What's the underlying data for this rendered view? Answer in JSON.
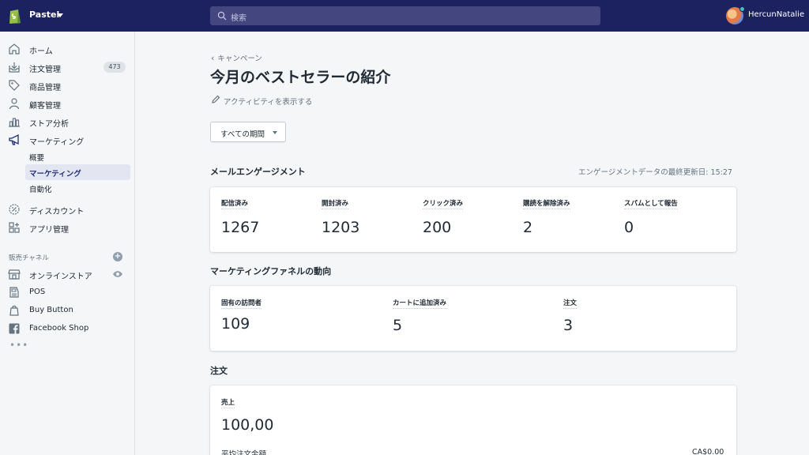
{
  "topbar": {
    "store_name": "Pastel",
    "search_placeholder": "検索",
    "username": "HercunNatalie"
  },
  "sidebar": {
    "items": [
      {
        "label": "ホーム",
        "icon": "home-icon"
      },
      {
        "label": "注文管理",
        "icon": "orders-icon",
        "badge": "473"
      },
      {
        "label": "商品管理",
        "icon": "tag-icon"
      },
      {
        "label": "顧客管理",
        "icon": "customer-icon"
      },
      {
        "label": "ストア分析",
        "icon": "analytics-icon"
      },
      {
        "label": "マーケティング",
        "icon": "megaphone-icon"
      }
    ],
    "marketing_sub": [
      {
        "label": "概要"
      },
      {
        "label": "マーケティング",
        "active": true
      },
      {
        "label": "自動化"
      }
    ],
    "lower_items": [
      {
        "label": "ディスカウント",
        "icon": "discount-icon"
      },
      {
        "label": "アプリ管理",
        "icon": "apps-icon"
      }
    ],
    "channels_title": "販売チャネル",
    "channels": [
      {
        "label": "オンラインストア",
        "icon": "store-icon"
      },
      {
        "label": "POS",
        "icon": "pos-icon"
      },
      {
        "label": "Buy Button",
        "icon": "buy-button-icon"
      },
      {
        "label": "Facebook Shop",
        "icon": "facebook-icon"
      }
    ],
    "more": "•••"
  },
  "main": {
    "breadcrumb": "キャンペーン",
    "title": "今月のベストセラーの紹介",
    "activity_link": "アクティビティを表示する",
    "period_select": "すべての期間"
  },
  "email": {
    "heading": "メールエンゲージメント",
    "updated": "エンゲージメントデータの最終更新日: 15:27",
    "metrics": [
      {
        "label": "配信済み",
        "value": "1267"
      },
      {
        "label": "開封済み",
        "value": "1203"
      },
      {
        "label": "クリック済み",
        "value": "200"
      },
      {
        "label": "購読を解除済み",
        "value": "2"
      },
      {
        "label": "スパムとして報告",
        "value": "0"
      }
    ]
  },
  "funnel": {
    "heading": "マーケティングファネルの動向",
    "metrics": [
      {
        "label": "固有の訪問者",
        "value": "109"
      },
      {
        "label": "カートに追加済み",
        "value": "5"
      },
      {
        "label": "注文",
        "value": "3"
      }
    ]
  },
  "orders": {
    "heading": "注文",
    "sales_label": "売上",
    "sales_value": "100,00",
    "avg_label": "平均注文金額",
    "avg_value": "CA$0.00"
  },
  "colors": {
    "topbar": "#1c2260",
    "search_bg": "#43467f",
    "active_nav": "#202e78"
  }
}
